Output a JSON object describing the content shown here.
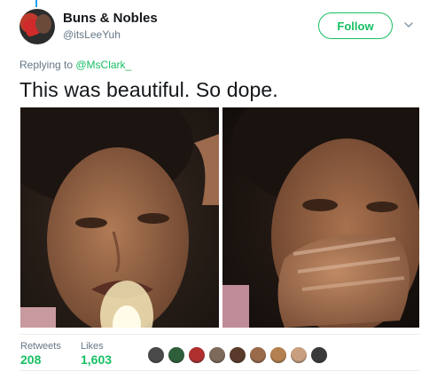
{
  "tweet": {
    "author": {
      "display_name": "Buns & Nobles",
      "handle": "@itsLeeYuh"
    },
    "follow_label": "Follow",
    "replying_prefix": "Replying to ",
    "replying_to": "@MsClark_",
    "text": "This was beautiful. So dope.",
    "stats": {
      "retweets_label": "Retweets",
      "retweets_value": "208",
      "likes_label": "Likes",
      "likes_value": "1,603"
    },
    "likers": [
      {
        "name": "liker-avatar-1",
        "color": "#4a4a4a"
      },
      {
        "name": "liker-avatar-2",
        "color": "#2e5e3a"
      },
      {
        "name": "liker-avatar-3",
        "color": "#b03030"
      },
      {
        "name": "liker-avatar-4",
        "color": "#7d6a5a"
      },
      {
        "name": "liker-avatar-5",
        "color": "#5a3a2a"
      },
      {
        "name": "liker-avatar-6",
        "color": "#9a6a4a"
      },
      {
        "name": "liker-avatar-7",
        "color": "#b5804f"
      },
      {
        "name": "liker-avatar-8",
        "color": "#c8a080"
      },
      {
        "name": "liker-avatar-9",
        "color": "#3a3a3a"
      }
    ]
  },
  "colors": {
    "accent_green": "#17bf63",
    "text_primary": "#14171a",
    "text_secondary": "#657786",
    "thread_line": "#1da1f2"
  }
}
